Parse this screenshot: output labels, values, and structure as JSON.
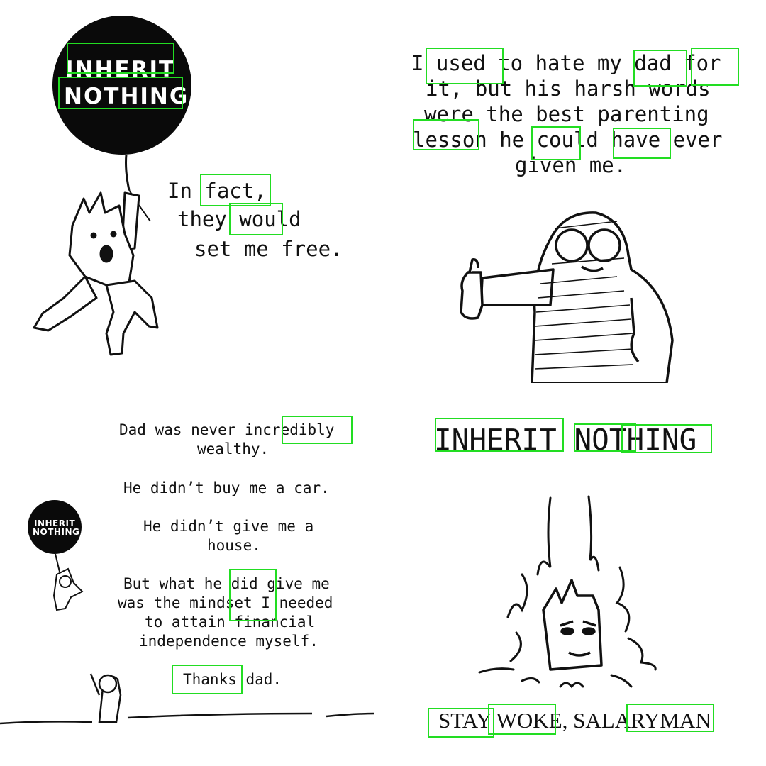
{
  "panel1": {
    "balloon_line1": "INHERIT",
    "balloon_line2": "NOTHING",
    "text_line1": "In fact,",
    "text_line2": "they would",
    "text_line3": "set me free."
  },
  "panel2": {
    "text_line1": "I used to hate my dad for",
    "text_line2": "it, but his harsh words",
    "text_line3": "were the best parenting",
    "text_line4": "lesson he could have ever",
    "text_line5": "given me."
  },
  "panel3": {
    "balloon_line1": "INHERIT",
    "balloon_line2": "NOTHING",
    "para1_line1": "Dad was never incredibly",
    "para1_line2": "wealthy.",
    "para2": "He didn’t buy me a car.",
    "para3_line1": "He didn’t give me a",
    "para3_line2": "house.",
    "para4_line1": "But what he did give me",
    "para4_line2": "was the mindset I needed",
    "para4_line3": "to attain financial",
    "para4_line4": "independence myself.",
    "para5": "Thanks dad."
  },
  "panel4": {
    "title": "INHERIT NOTHING",
    "footer": "STAY WOKE, SALARYMAN"
  },
  "colors": {
    "ink": "#111111",
    "highlight_box": "#22dd22",
    "background": "#ffffff"
  }
}
